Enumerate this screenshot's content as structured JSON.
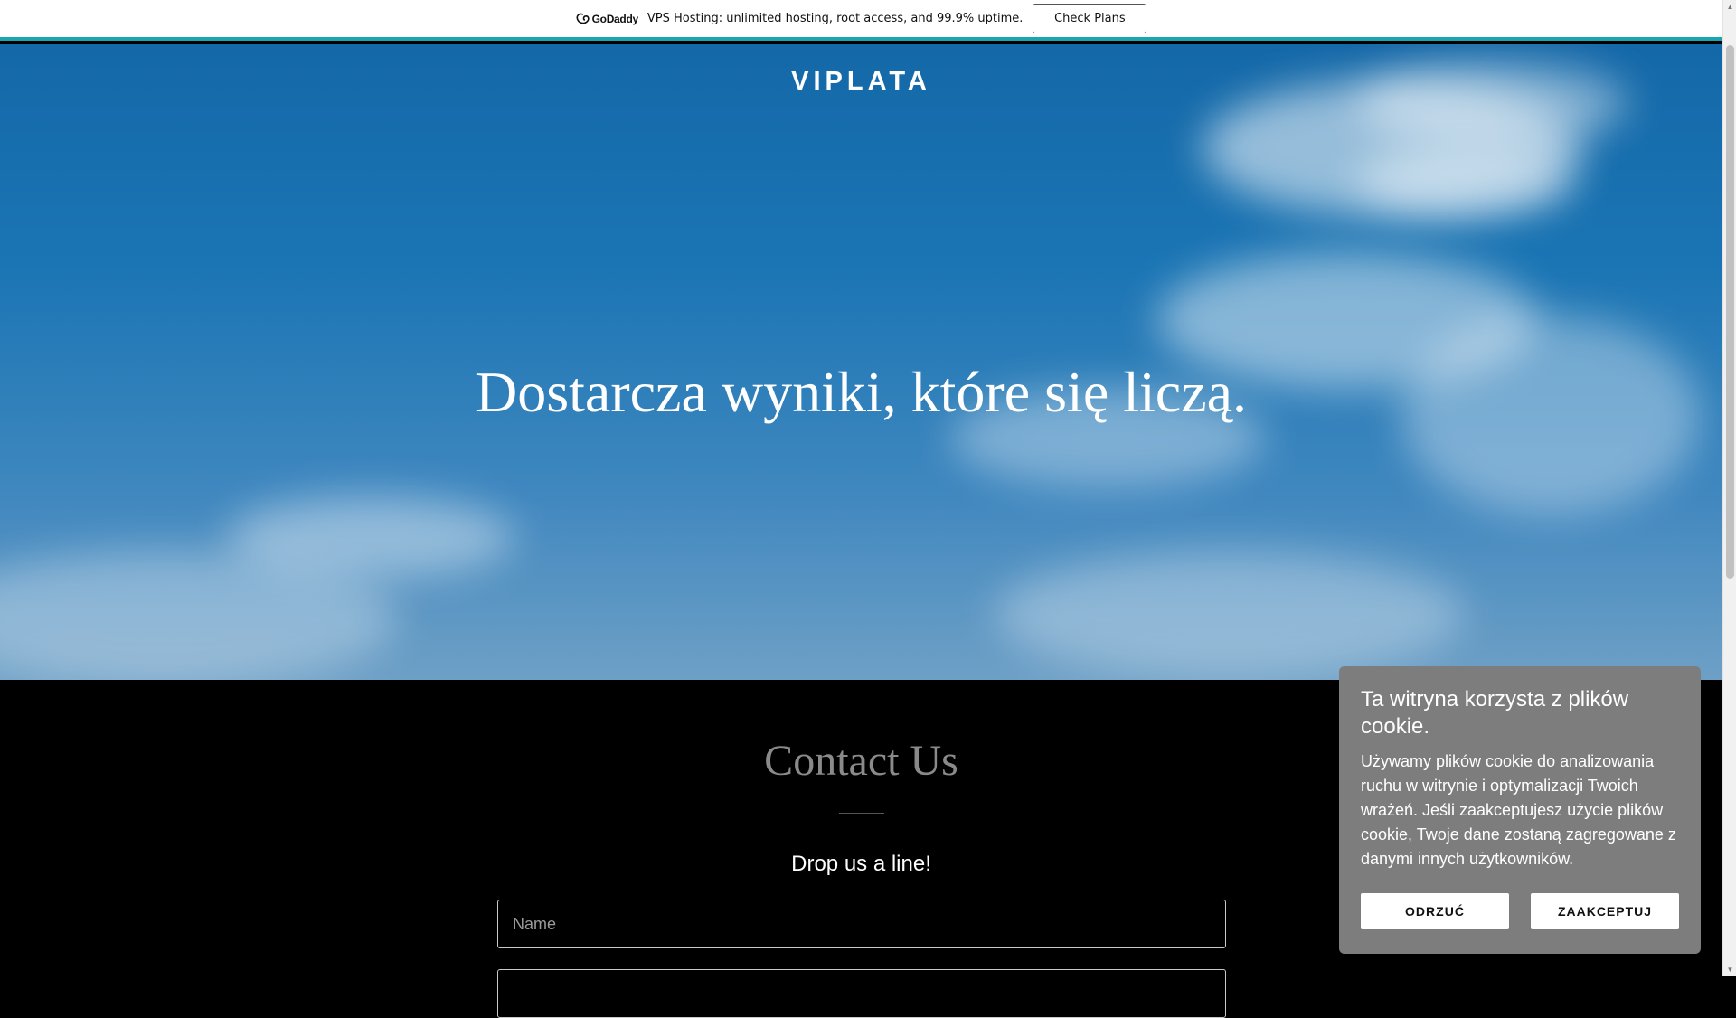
{
  "promo": {
    "logo_text": "GoDaddy",
    "logo_icon": "godaddy-logo-icon",
    "message": "VPS Hosting: unlimited hosting, root access, and 99.9% uptime.",
    "button_label": "Check Plans",
    "accent_color": "#1aa5b3"
  },
  "hero": {
    "brand": "VIPLATA",
    "tagline": "Dostarcza wyniki, które się liczą."
  },
  "contact": {
    "title": "Contact Us",
    "subtitle": "Drop us a line!",
    "name_placeholder": "Name"
  },
  "cookie": {
    "title": "Ta witryna korzysta z plików cookie.",
    "body": "Używamy plików cookie do analizowania ruchu w witrynie i optymalizacji Twoich wrażeń. Jeśli zaakceptujesz użycie plików cookie, Twoje dane zostaną zagregowane z danymi innych użytkowników.",
    "decline_label": "ODRZUĆ",
    "accept_label": "ZAAKCEPTUJ"
  }
}
